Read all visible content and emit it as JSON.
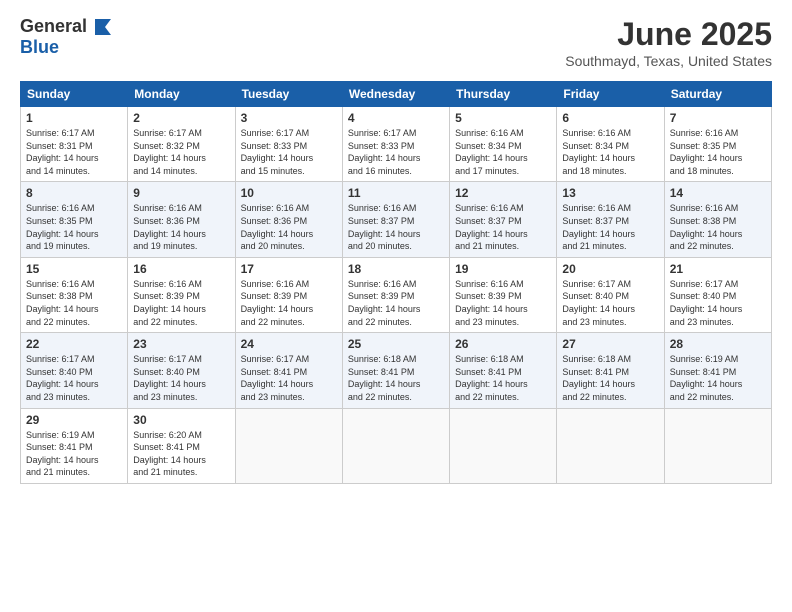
{
  "logo": {
    "general": "General",
    "blue": "Blue"
  },
  "header": {
    "title": "June 2025",
    "location": "Southmayd, Texas, United States"
  },
  "days": [
    "Sunday",
    "Monday",
    "Tuesday",
    "Wednesday",
    "Thursday",
    "Friday",
    "Saturday"
  ],
  "weeks": [
    [
      {
        "day": "1",
        "rise": "6:17 AM",
        "set": "8:31 PM",
        "hours": "14 hours",
        "mins": "14 minutes"
      },
      {
        "day": "2",
        "rise": "6:17 AM",
        "set": "8:32 PM",
        "hours": "14 hours",
        "mins": "14 minutes"
      },
      {
        "day": "3",
        "rise": "6:17 AM",
        "set": "8:33 PM",
        "hours": "14 hours",
        "mins": "15 minutes"
      },
      {
        "day": "4",
        "rise": "6:17 AM",
        "set": "8:33 PM",
        "hours": "14 hours",
        "mins": "16 minutes"
      },
      {
        "day": "5",
        "rise": "6:16 AM",
        "set": "8:34 PM",
        "hours": "14 hours",
        "mins": "17 minutes"
      },
      {
        "day": "6",
        "rise": "6:16 AM",
        "set": "8:34 PM",
        "hours": "14 hours",
        "mins": "18 minutes"
      },
      {
        "day": "7",
        "rise": "6:16 AM",
        "set": "8:35 PM",
        "hours": "14 hours",
        "mins": "18 minutes"
      }
    ],
    [
      {
        "day": "8",
        "rise": "6:16 AM",
        "set": "8:35 PM",
        "hours": "14 hours",
        "mins": "19 minutes"
      },
      {
        "day": "9",
        "rise": "6:16 AM",
        "set": "8:36 PM",
        "hours": "14 hours",
        "mins": "19 minutes"
      },
      {
        "day": "10",
        "rise": "6:16 AM",
        "set": "8:36 PM",
        "hours": "14 hours",
        "mins": "20 minutes"
      },
      {
        "day": "11",
        "rise": "6:16 AM",
        "set": "8:37 PM",
        "hours": "14 hours",
        "mins": "20 minutes"
      },
      {
        "day": "12",
        "rise": "6:16 AM",
        "set": "8:37 PM",
        "hours": "14 hours",
        "mins": "21 minutes"
      },
      {
        "day": "13",
        "rise": "6:16 AM",
        "set": "8:37 PM",
        "hours": "14 hours",
        "mins": "21 minutes"
      },
      {
        "day": "14",
        "rise": "6:16 AM",
        "set": "8:38 PM",
        "hours": "14 hours",
        "mins": "22 minutes"
      }
    ],
    [
      {
        "day": "15",
        "rise": "6:16 AM",
        "set": "8:38 PM",
        "hours": "14 hours",
        "mins": "22 minutes"
      },
      {
        "day": "16",
        "rise": "6:16 AM",
        "set": "8:39 PM",
        "hours": "14 hours",
        "mins": "22 minutes"
      },
      {
        "day": "17",
        "rise": "6:16 AM",
        "set": "8:39 PM",
        "hours": "14 hours",
        "mins": "22 minutes"
      },
      {
        "day": "18",
        "rise": "6:16 AM",
        "set": "8:39 PM",
        "hours": "14 hours",
        "mins": "22 minutes"
      },
      {
        "day": "19",
        "rise": "6:16 AM",
        "set": "8:39 PM",
        "hours": "14 hours",
        "mins": "23 minutes"
      },
      {
        "day": "20",
        "rise": "6:17 AM",
        "set": "8:40 PM",
        "hours": "14 hours",
        "mins": "23 minutes"
      },
      {
        "day": "21",
        "rise": "6:17 AM",
        "set": "8:40 PM",
        "hours": "14 hours",
        "mins": "23 minutes"
      }
    ],
    [
      {
        "day": "22",
        "rise": "6:17 AM",
        "set": "8:40 PM",
        "hours": "14 hours",
        "mins": "23 minutes"
      },
      {
        "day": "23",
        "rise": "6:17 AM",
        "set": "8:40 PM",
        "hours": "14 hours",
        "mins": "23 minutes"
      },
      {
        "day": "24",
        "rise": "6:17 AM",
        "set": "8:41 PM",
        "hours": "14 hours",
        "mins": "23 minutes"
      },
      {
        "day": "25",
        "rise": "6:18 AM",
        "set": "8:41 PM",
        "hours": "14 hours",
        "mins": "22 minutes"
      },
      {
        "day": "26",
        "rise": "6:18 AM",
        "set": "8:41 PM",
        "hours": "14 hours",
        "mins": "22 minutes"
      },
      {
        "day": "27",
        "rise": "6:18 AM",
        "set": "8:41 PM",
        "hours": "14 hours",
        "mins": "22 minutes"
      },
      {
        "day": "28",
        "rise": "6:19 AM",
        "set": "8:41 PM",
        "hours": "14 hours",
        "mins": "22 minutes"
      }
    ],
    [
      {
        "day": "29",
        "rise": "6:19 AM",
        "set": "8:41 PM",
        "hours": "14 hours",
        "mins": "21 minutes"
      },
      {
        "day": "30",
        "rise": "6:20 AM",
        "set": "8:41 PM",
        "hours": "14 hours",
        "mins": "21 minutes"
      },
      null,
      null,
      null,
      null,
      null
    ]
  ]
}
